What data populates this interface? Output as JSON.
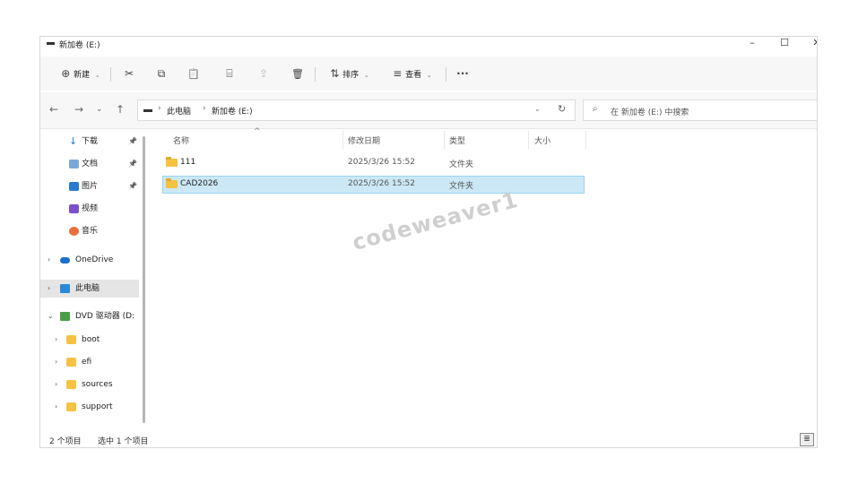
{
  "window": {
    "title": "新加卷 (E:)",
    "minimize": "–",
    "maximize": "☐",
    "close": "✕"
  },
  "toolbar": {
    "new_icon": "⊕",
    "new_label": "新建",
    "cut_icon": "✂",
    "copy_icon": "⧉",
    "paste_icon": "📋",
    "rename_icon": "⌸",
    "share_icon": "⇪",
    "delete_icon": "🗑",
    "sort_icon": "⇅",
    "sort_label": "排序",
    "view_icon": "≡",
    "view_label": "查看",
    "more_label": "···",
    "caret": "⌄"
  },
  "nav": {
    "back": "←",
    "forward": "→",
    "recent": "⌄",
    "up": "↑"
  },
  "address": {
    "crumbs": [
      "此电脑",
      "新加卷 (E:)"
    ],
    "separator": "›",
    "dropdown": "⌄",
    "refresh": "↻"
  },
  "search": {
    "icon": "⌕",
    "placeholder": "在 新加卷 (E:) 中搜索"
  },
  "sidebar": {
    "items": [
      {
        "label": "下载",
        "pinned": true
      },
      {
        "label": "文档",
        "pinned": true
      },
      {
        "label": "图片",
        "pinned": true
      },
      {
        "label": "视频",
        "pinned": false
      },
      {
        "label": "音乐",
        "pinned": false
      },
      {
        "label": "OneDrive"
      },
      {
        "label": "此电脑",
        "selected": true
      },
      {
        "label": "DVD 驱动器 (D:"
      },
      {
        "label": "boot"
      },
      {
        "label": "efi"
      },
      {
        "label": "sources"
      },
      {
        "label": "support"
      }
    ],
    "pin_glyph": "📌",
    "chev_right": "›",
    "chev_down": "⌄"
  },
  "columns": {
    "name": "名称",
    "modified": "修改日期",
    "type": "类型",
    "size": "大小",
    "sort_arrow": "^"
  },
  "files": [
    {
      "name": "111",
      "modified": "2025/3/26 15:52",
      "type": "文件夹",
      "size": "",
      "selected": false
    },
    {
      "name": "CAD2026",
      "modified": "2025/3/26 15:52",
      "type": "文件夹",
      "size": "",
      "selected": true
    }
  ],
  "status": {
    "count": "2 个项目",
    "selected": "选中 1 个项目",
    "view_icon": "≣"
  },
  "watermark": "codeweaver1",
  "colors": {
    "selection_bg": "#cce8f7",
    "selection_border": "#99d1f0",
    "folder": "#f5c242",
    "toolbar_bg": "#f7f7f7"
  }
}
